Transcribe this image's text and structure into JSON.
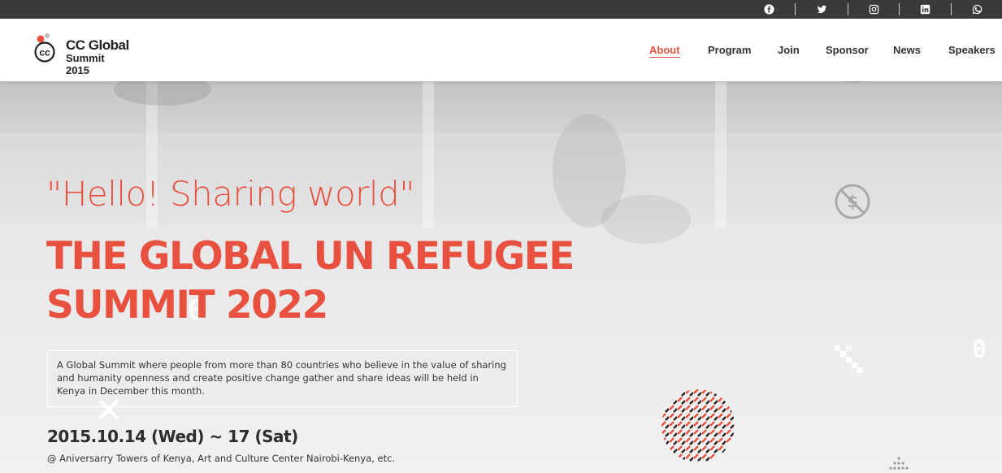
{
  "topbar": {
    "social": [
      {
        "icon": "facebook-icon"
      },
      {
        "icon": "twitter-icon"
      },
      {
        "icon": "instagram-icon"
      },
      {
        "icon": "linkedin-icon"
      },
      {
        "icon": "whatsapp-icon"
      }
    ]
  },
  "header": {
    "logo": {
      "mark": "cc",
      "line1": "CC Global",
      "line2": "Summit 2015"
    },
    "nav": [
      {
        "label": "About",
        "active": true
      },
      {
        "label": "Program",
        "active": false
      },
      {
        "label": "Join",
        "active": false
      },
      {
        "label": "Sponsor",
        "active": false
      },
      {
        "label": "News",
        "active": false
      },
      {
        "label": "Speakers",
        "active": false
      }
    ]
  },
  "hero": {
    "subtitle": "\"Hello! Sharing world\"",
    "title_line1": "THE GLOBAL UN REFUGEE",
    "title_line2": "SUMMIT 2022",
    "description": "A Global Summit where people from more than 80 countries who believe in the value of sharing and humanity openness and create positive change gather and share ideas will be held in Kenya in December this month.",
    "date": "2015.10.14 (Wed) ~ 17 (Sat)",
    "venue": "@ Aniversarry Towers of Kenya, Art and Culture Center Nairobi-Kenya, etc."
  },
  "colors": {
    "accent": "#e8513f",
    "topbar": "#3a3a3a",
    "text_dark": "#2d2d2d"
  }
}
